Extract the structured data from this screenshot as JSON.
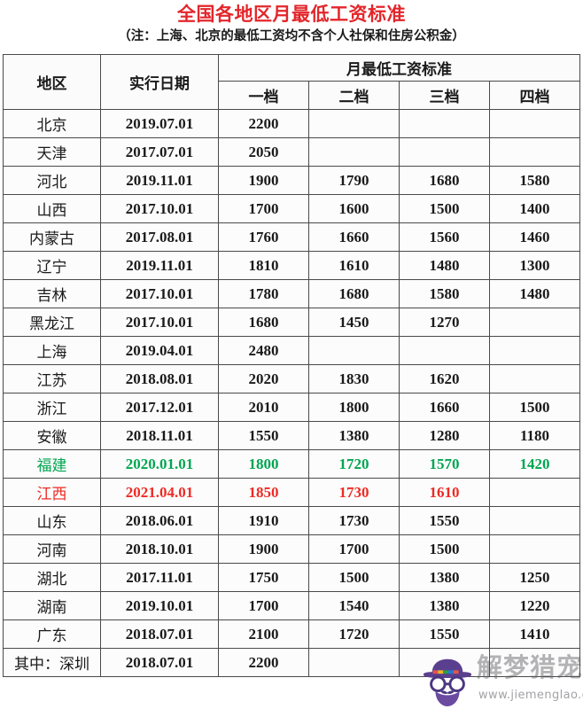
{
  "document": {
    "main_title": "全国各地区月最低工资标准",
    "sub_title": "（注：上海、北京的最低工资均不含个人社保和住房公积金）",
    "title_color": "#e3262b",
    "subtitle_color": "#1a1a1a"
  },
  "table": {
    "headers": {
      "region": "地区",
      "date": "实行日期",
      "group": "月最低工资标准",
      "tier1": "一档",
      "tier2": "二档",
      "tier3": "三档",
      "tier4": "四档"
    },
    "highlight_colors": {
      "green": "#00a550",
      "red": "#ee2a24",
      "default": "#1a1a1a"
    },
    "rows": [
      {
        "region": "北京",
        "date": "2019.07.01",
        "tier1": "2200",
        "tier2": "",
        "tier3": "",
        "tier4": "",
        "color": "default"
      },
      {
        "region": "天津",
        "date": "2017.07.01",
        "tier1": "2050",
        "tier2": "",
        "tier3": "",
        "tier4": "",
        "color": "default"
      },
      {
        "region": "河北",
        "date": "2019.11.01",
        "tier1": "1900",
        "tier2": "1790",
        "tier3": "1680",
        "tier4": "1580",
        "color": "default"
      },
      {
        "region": "山西",
        "date": "2017.10.01",
        "tier1": "1700",
        "tier2": "1600",
        "tier3": "1500",
        "tier4": "1400",
        "color": "default"
      },
      {
        "region": "内蒙古",
        "date": "2017.08.01",
        "tier1": "1760",
        "tier2": "1660",
        "tier3": "1560",
        "tier4": "1460",
        "color": "default"
      },
      {
        "region": "辽宁",
        "date": "2019.11.01",
        "tier1": "1810",
        "tier2": "1610",
        "tier3": "1480",
        "tier4": "1300",
        "color": "default"
      },
      {
        "region": "吉林",
        "date": "2017.10.01",
        "tier1": "1780",
        "tier2": "1680",
        "tier3": "1580",
        "tier4": "1480",
        "color": "default"
      },
      {
        "region": "黑龙江",
        "date": "2017.10.01",
        "tier1": "1680",
        "tier2": "1450",
        "tier3": "1270",
        "tier4": "",
        "color": "default"
      },
      {
        "region": "上海",
        "date": "2019.04.01",
        "tier1": "2480",
        "tier2": "",
        "tier3": "",
        "tier4": "",
        "color": "default"
      },
      {
        "region": "江苏",
        "date": "2018.08.01",
        "tier1": "2020",
        "tier2": "1830",
        "tier3": "1620",
        "tier4": "",
        "color": "default"
      },
      {
        "region": "浙江",
        "date": "2017.12.01",
        "tier1": "2010",
        "tier2": "1800",
        "tier3": "1660",
        "tier4": "1500",
        "color": "default"
      },
      {
        "region": "安徽",
        "date": "2018.11.01",
        "tier1": "1550",
        "tier2": "1380",
        "tier3": "1280",
        "tier4": "1180",
        "color": "default"
      },
      {
        "region": "福建",
        "date": "2020.01.01",
        "tier1": "1800",
        "tier2": "1720",
        "tier3": "1570",
        "tier4": "1420",
        "color": "green"
      },
      {
        "region": "江西",
        "date": "2021.04.01",
        "tier1": "1850",
        "tier2": "1730",
        "tier3": "1610",
        "tier4": "",
        "color": "red"
      },
      {
        "region": "山东",
        "date": "2018.06.01",
        "tier1": "1910",
        "tier2": "1730",
        "tier3": "1550",
        "tier4": "",
        "color": "default"
      },
      {
        "region": "河南",
        "date": "2018.10.01",
        "tier1": "1900",
        "tier2": "1700",
        "tier3": "1500",
        "tier4": "",
        "color": "default"
      },
      {
        "region": "湖北",
        "date": "2017.11.01",
        "tier1": "1750",
        "tier2": "1500",
        "tier3": "1380",
        "tier4": "1250",
        "color": "default"
      },
      {
        "region": "湖南",
        "date": "2019.10.01",
        "tier1": "1700",
        "tier2": "1540",
        "tier3": "1380",
        "tier4": "1220",
        "color": "default"
      },
      {
        "region": "广东",
        "date": "2018.07.01",
        "tier1": "2100",
        "tier2": "1720",
        "tier3": "1550",
        "tier4": "1410",
        "color": "default"
      },
      {
        "region": "其中：深圳",
        "date": "2018.07.01",
        "tier1": "2200",
        "tier2": "",
        "tier3": "",
        "tier4": "",
        "color": "default"
      }
    ]
  },
  "watermark": {
    "brand_text": "解梦猎宠",
    "url": "www.jiemenglao.com",
    "logo_name": "hipster-face-logo",
    "color": "#5a5a5f"
  }
}
